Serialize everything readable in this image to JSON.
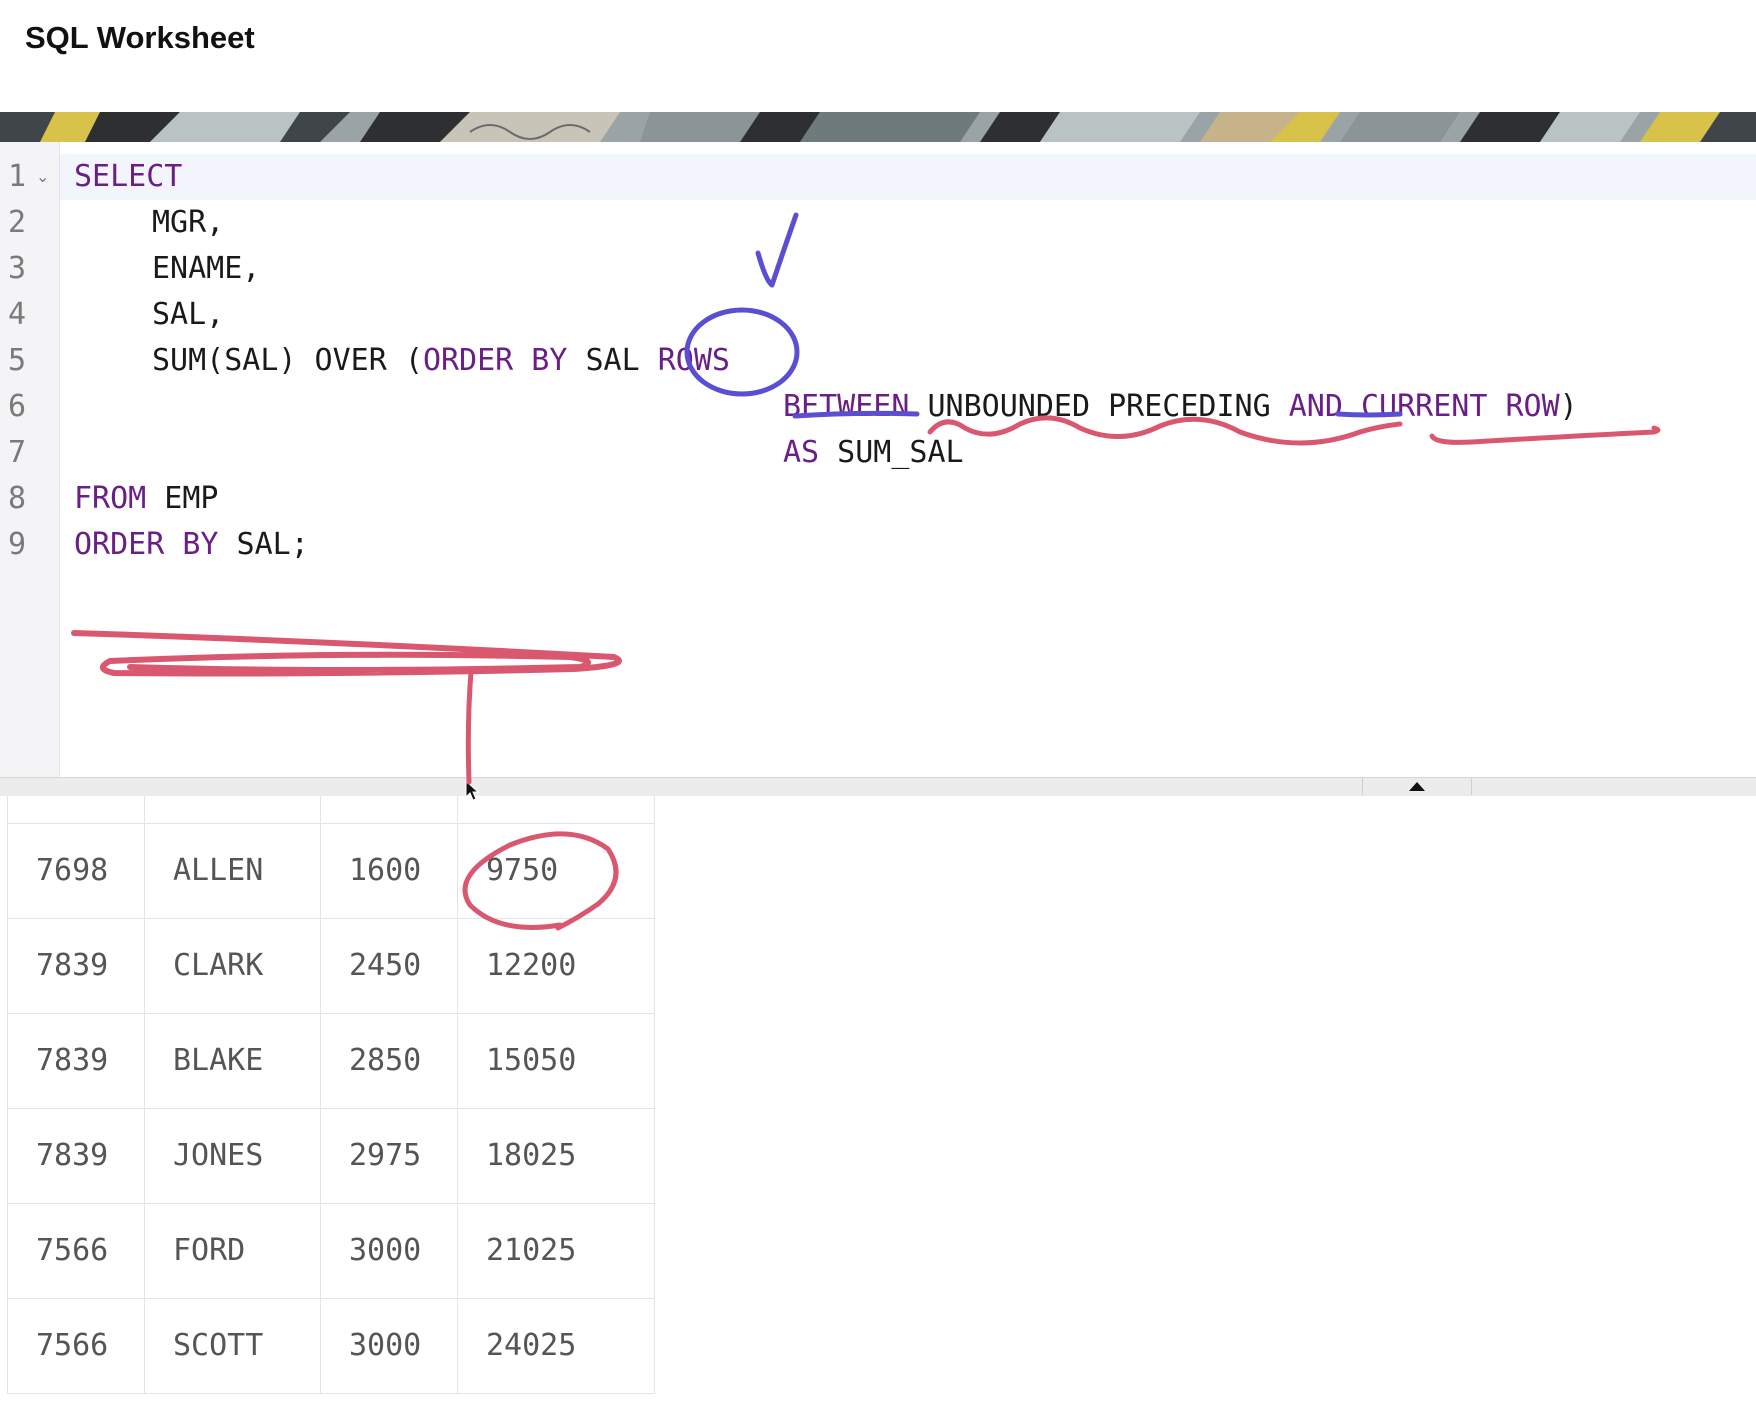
{
  "window": {
    "title": "SQL Worksheet"
  },
  "editor": {
    "line_numbers": [
      "1",
      "2",
      "3",
      "4",
      "5",
      "6",
      "7",
      "8",
      "9"
    ],
    "lines": [
      {
        "kw1": "SELECT",
        "txt1": "",
        "kw2": "",
        "txt2": ""
      },
      {
        "kw1": "",
        "txt1": "MGR,",
        "kw2": "",
        "txt2": ""
      },
      {
        "kw1": "",
        "txt1": "ENAME,",
        "kw2": "",
        "txt2": ""
      },
      {
        "kw1": "",
        "txt1": "SAL,",
        "kw2": "",
        "txt2": ""
      },
      {
        "txt1": "SUM(SAL) OVER (",
        "kw1": "ORDER BY",
        "txt2": " SAL ",
        "kw2": "ROWS"
      },
      {
        "kw1": "BETWEEN",
        "txt1": " UNBOUNDED PRECEDING ",
        "kw2": "AND",
        "kw3": " CURRENT ROW",
        "txt2": ")"
      },
      {
        "kw1": "AS",
        "txt1": " SUM_SAL"
      },
      {
        "kw1": "FROM",
        "txt1": " EMP"
      },
      {
        "kw1": "ORDER BY",
        "txt1": " SAL;"
      }
    ]
  },
  "results": {
    "rows": [
      [
        "7698",
        "ALLEN",
        "1600",
        "9750"
      ],
      [
        "7839",
        "CLARK",
        "2450",
        "12200"
      ],
      [
        "7839",
        "BLAKE",
        "2850",
        "15050"
      ],
      [
        "7839",
        "JONES",
        "2975",
        "18025"
      ],
      [
        "7566",
        "FORD",
        "3000",
        "21025"
      ],
      [
        "7566",
        "SCOTT",
        "3000",
        "24025"
      ]
    ]
  },
  "annotations": {
    "pen_colors": {
      "blue": "#5b4fd1",
      "red": "#d9586f"
    },
    "banner_colors": [
      "#3f4548",
      "#d8c24a",
      "#b9c3c4",
      "#8b9597",
      "#2d2f30",
      "#c7b38a"
    ]
  },
  "icons": {
    "fold": "chevron-down-icon",
    "splitter": "caret-up-icon",
    "cursor": "mouse-pointer-icon"
  }
}
